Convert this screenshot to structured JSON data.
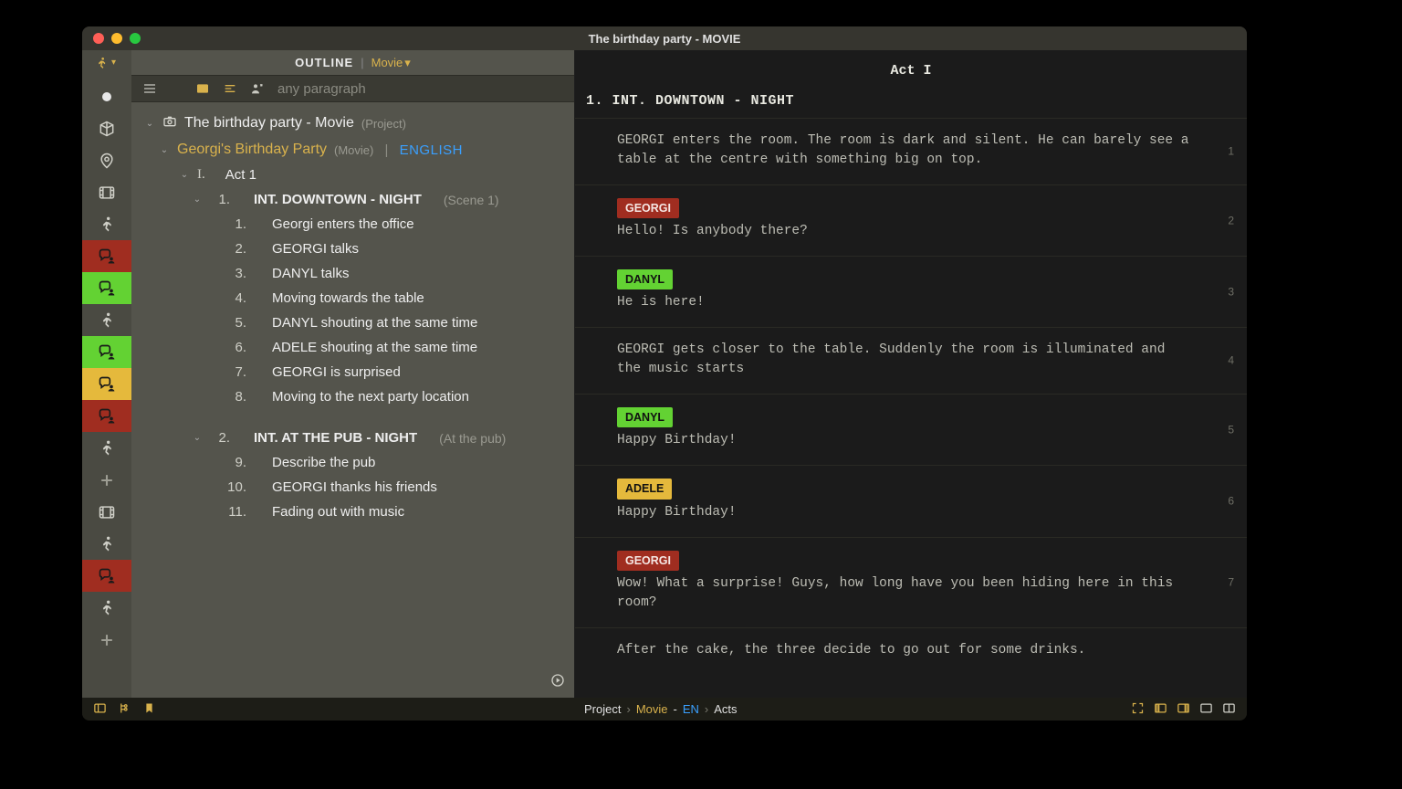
{
  "window_title": "The birthday party - MOVIE",
  "outline_header": {
    "label": "OUTLINE",
    "mode": "Movie"
  },
  "filter": {
    "placeholder": "any paragraph"
  },
  "project": {
    "title": "The birthday party - Movie",
    "meta": "(Project)"
  },
  "movie": {
    "name": "Georgi's Birthday Party",
    "type": "(Movie)",
    "lang": "ENGLISH"
  },
  "act": {
    "roman": "I.",
    "title": "Act 1"
  },
  "scenes": [
    {
      "num": "1.",
      "heading": "INT.  DOWNTOWN - NIGHT",
      "meta": "(Scene 1)",
      "beats": [
        {
          "n": "1.",
          "t": "Georgi enters the office"
        },
        {
          "n": "2.",
          "t": "GEORGI talks"
        },
        {
          "n": "3.",
          "t": "DANYL talks"
        },
        {
          "n": "4.",
          "t": "Moving towards the table"
        },
        {
          "n": "5.",
          "t": "DANYL shouting at the same time"
        },
        {
          "n": "6.",
          "t": "ADELE shouting at the same time"
        },
        {
          "n": "7.",
          "t": "GEORGI is surprised"
        },
        {
          "n": "8.",
          "t": "Moving to the next party location"
        }
      ]
    },
    {
      "num": "2.",
      "heading": "INT.  AT THE PUB - NIGHT",
      "meta": "(At the pub)",
      "beats": [
        {
          "n": "9.",
          "t": "Describe the pub"
        },
        {
          "n": "10.",
          "t": "GEORGI thanks his friends"
        },
        {
          "n": "11.",
          "t": "Fading out with music"
        }
      ]
    }
  ],
  "script": {
    "act_title": "Act I",
    "scene_heading": "1.  INT. DOWNTOWN - NIGHT",
    "blocks": [
      {
        "kind": "action",
        "text": "GEORGI enters the room. The room is dark and silent. He can barely see a table at the centre with something big on top.",
        "p": "1"
      },
      {
        "kind": "dialogue",
        "char": "GEORGI",
        "color": "red",
        "text": "Hello! Is anybody there?",
        "p": "2"
      },
      {
        "kind": "dialogue",
        "char": "DANYL",
        "color": "green",
        "text": "He is here!",
        "p": "3"
      },
      {
        "kind": "action",
        "text": "GEORGI gets closer to the table. Suddenly the room is illuminated and the music starts",
        "p": "4"
      },
      {
        "kind": "dialogue",
        "char": "DANYL",
        "color": "green",
        "text": "Happy Birthday!",
        "p": "5"
      },
      {
        "kind": "dialogue",
        "char": "ADELE",
        "color": "yellow",
        "text": "Happy Birthday!",
        "p": "6"
      },
      {
        "kind": "dialogue",
        "char": "GEORGI",
        "color": "red",
        "text": "Wow! What a surprise! Guys, how long have you been hiding here in this room?",
        "p": "7"
      },
      {
        "kind": "action",
        "text": "After the cake, the three decide to go out for some drinks.",
        "p": ""
      }
    ]
  },
  "rail": [
    {
      "kind": "dot"
    },
    {
      "kind": "cube"
    },
    {
      "kind": "pin"
    },
    {
      "kind": "film"
    },
    {
      "kind": "run"
    },
    {
      "kind": "talk",
      "color": "red"
    },
    {
      "kind": "talk",
      "color": "green"
    },
    {
      "kind": "run"
    },
    {
      "kind": "talk",
      "color": "green"
    },
    {
      "kind": "talk",
      "color": "yellow"
    },
    {
      "kind": "talk",
      "color": "red"
    },
    {
      "kind": "run"
    },
    {
      "kind": "plus"
    },
    {
      "kind": "film"
    },
    {
      "kind": "run"
    },
    {
      "kind": "talk",
      "color": "red"
    },
    {
      "kind": "run"
    },
    {
      "kind": "plus"
    }
  ],
  "breadcrumb": {
    "a": "Project",
    "b": "Movie",
    "dash": " - ",
    "lang": "EN",
    "c": "Acts"
  }
}
